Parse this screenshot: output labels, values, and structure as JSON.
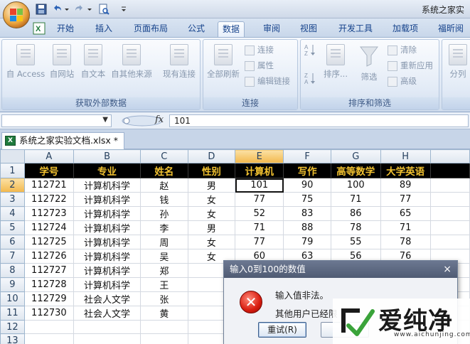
{
  "window": {
    "title": "系统之家实"
  },
  "ribbon_tabs": [
    {
      "label": "开始",
      "active": false
    },
    {
      "label": "插入",
      "active": false
    },
    {
      "label": "页面布局",
      "active": false
    },
    {
      "label": "公式",
      "active": false
    },
    {
      "label": "数据",
      "active": true
    },
    {
      "label": "审阅",
      "active": false
    },
    {
      "label": "视图",
      "active": false
    },
    {
      "label": "开发工具",
      "active": false
    },
    {
      "label": "加载项",
      "active": false
    },
    {
      "label": "福昕阅读",
      "active": false
    }
  ],
  "ribbon": {
    "external": {
      "label": "获取外部数据",
      "access": "自 Access",
      "web": "自网站",
      "text": "自文本",
      "other": "自其他来源",
      "existing": "现有连接"
    },
    "connections": {
      "label": "连接",
      "refresh_all": "全部刷新",
      "connections": "连接",
      "properties": "属性",
      "edit_links": "编辑链接"
    },
    "sort_filter": {
      "label": "排序和筛选",
      "sort": "排序...",
      "filter": "筛选",
      "clear": "清除",
      "reapply": "重新应用",
      "advanced": "高级"
    },
    "data_tools": {
      "split": "分列"
    }
  },
  "formula_bar": {
    "fx": "fx",
    "value": "101"
  },
  "document": {
    "tab_label": "系统之家实验文档.xlsx *",
    "xl_icon": "X"
  },
  "sheet": {
    "columns": [
      "A",
      "B",
      "C",
      "D",
      "E",
      "F",
      "G",
      "H"
    ],
    "rows": [
      "1",
      "2",
      "3",
      "4",
      "5",
      "6",
      "7",
      "8",
      "9",
      "10",
      "11",
      "12",
      "13"
    ],
    "header_row": [
      "学号",
      "专业",
      "姓名",
      "性别",
      "计算机",
      "写作",
      "高等数学",
      "大学英语"
    ],
    "data": [
      [
        "112721",
        "计算机科学",
        "赵",
        "男",
        "101",
        "90",
        "100",
        "89"
      ],
      [
        "112722",
        "计算机科学",
        "钱",
        "女",
        "77",
        "75",
        "71",
        "77"
      ],
      [
        "112723",
        "计算机科学",
        "孙",
        "女",
        "52",
        "83",
        "86",
        "65"
      ],
      [
        "112724",
        "计算机科学",
        "李",
        "男",
        "71",
        "88",
        "78",
        "71"
      ],
      [
        "112725",
        "计算机科学",
        "周",
        "女",
        "77",
        "79",
        "55",
        "78"
      ],
      [
        "112726",
        "计算机科学",
        "吴",
        "女",
        "60",
        "63",
        "56",
        "76"
      ],
      [
        "112727",
        "计算机科学",
        "郑",
        "",
        "",
        "",
        "",
        ""
      ],
      [
        "112728",
        "计算机科学",
        "王",
        "",
        "",
        "",
        "",
        ""
      ],
      [
        "112729",
        "社会人文学",
        "张",
        "",
        "",
        "",
        "",
        ""
      ],
      [
        "112730",
        "社会人文学",
        "黄",
        "",
        "",
        "",
        "",
        ""
      ]
    ]
  },
  "dialog": {
    "title": "输入0到100的数值",
    "close": "×",
    "message1": "输入值非法。",
    "message2": "其他用户已经限",
    "retry": "重试(R)"
  },
  "watermark": {
    "text": "爱纯净",
    "url": "www.aichunjing.com"
  }
}
